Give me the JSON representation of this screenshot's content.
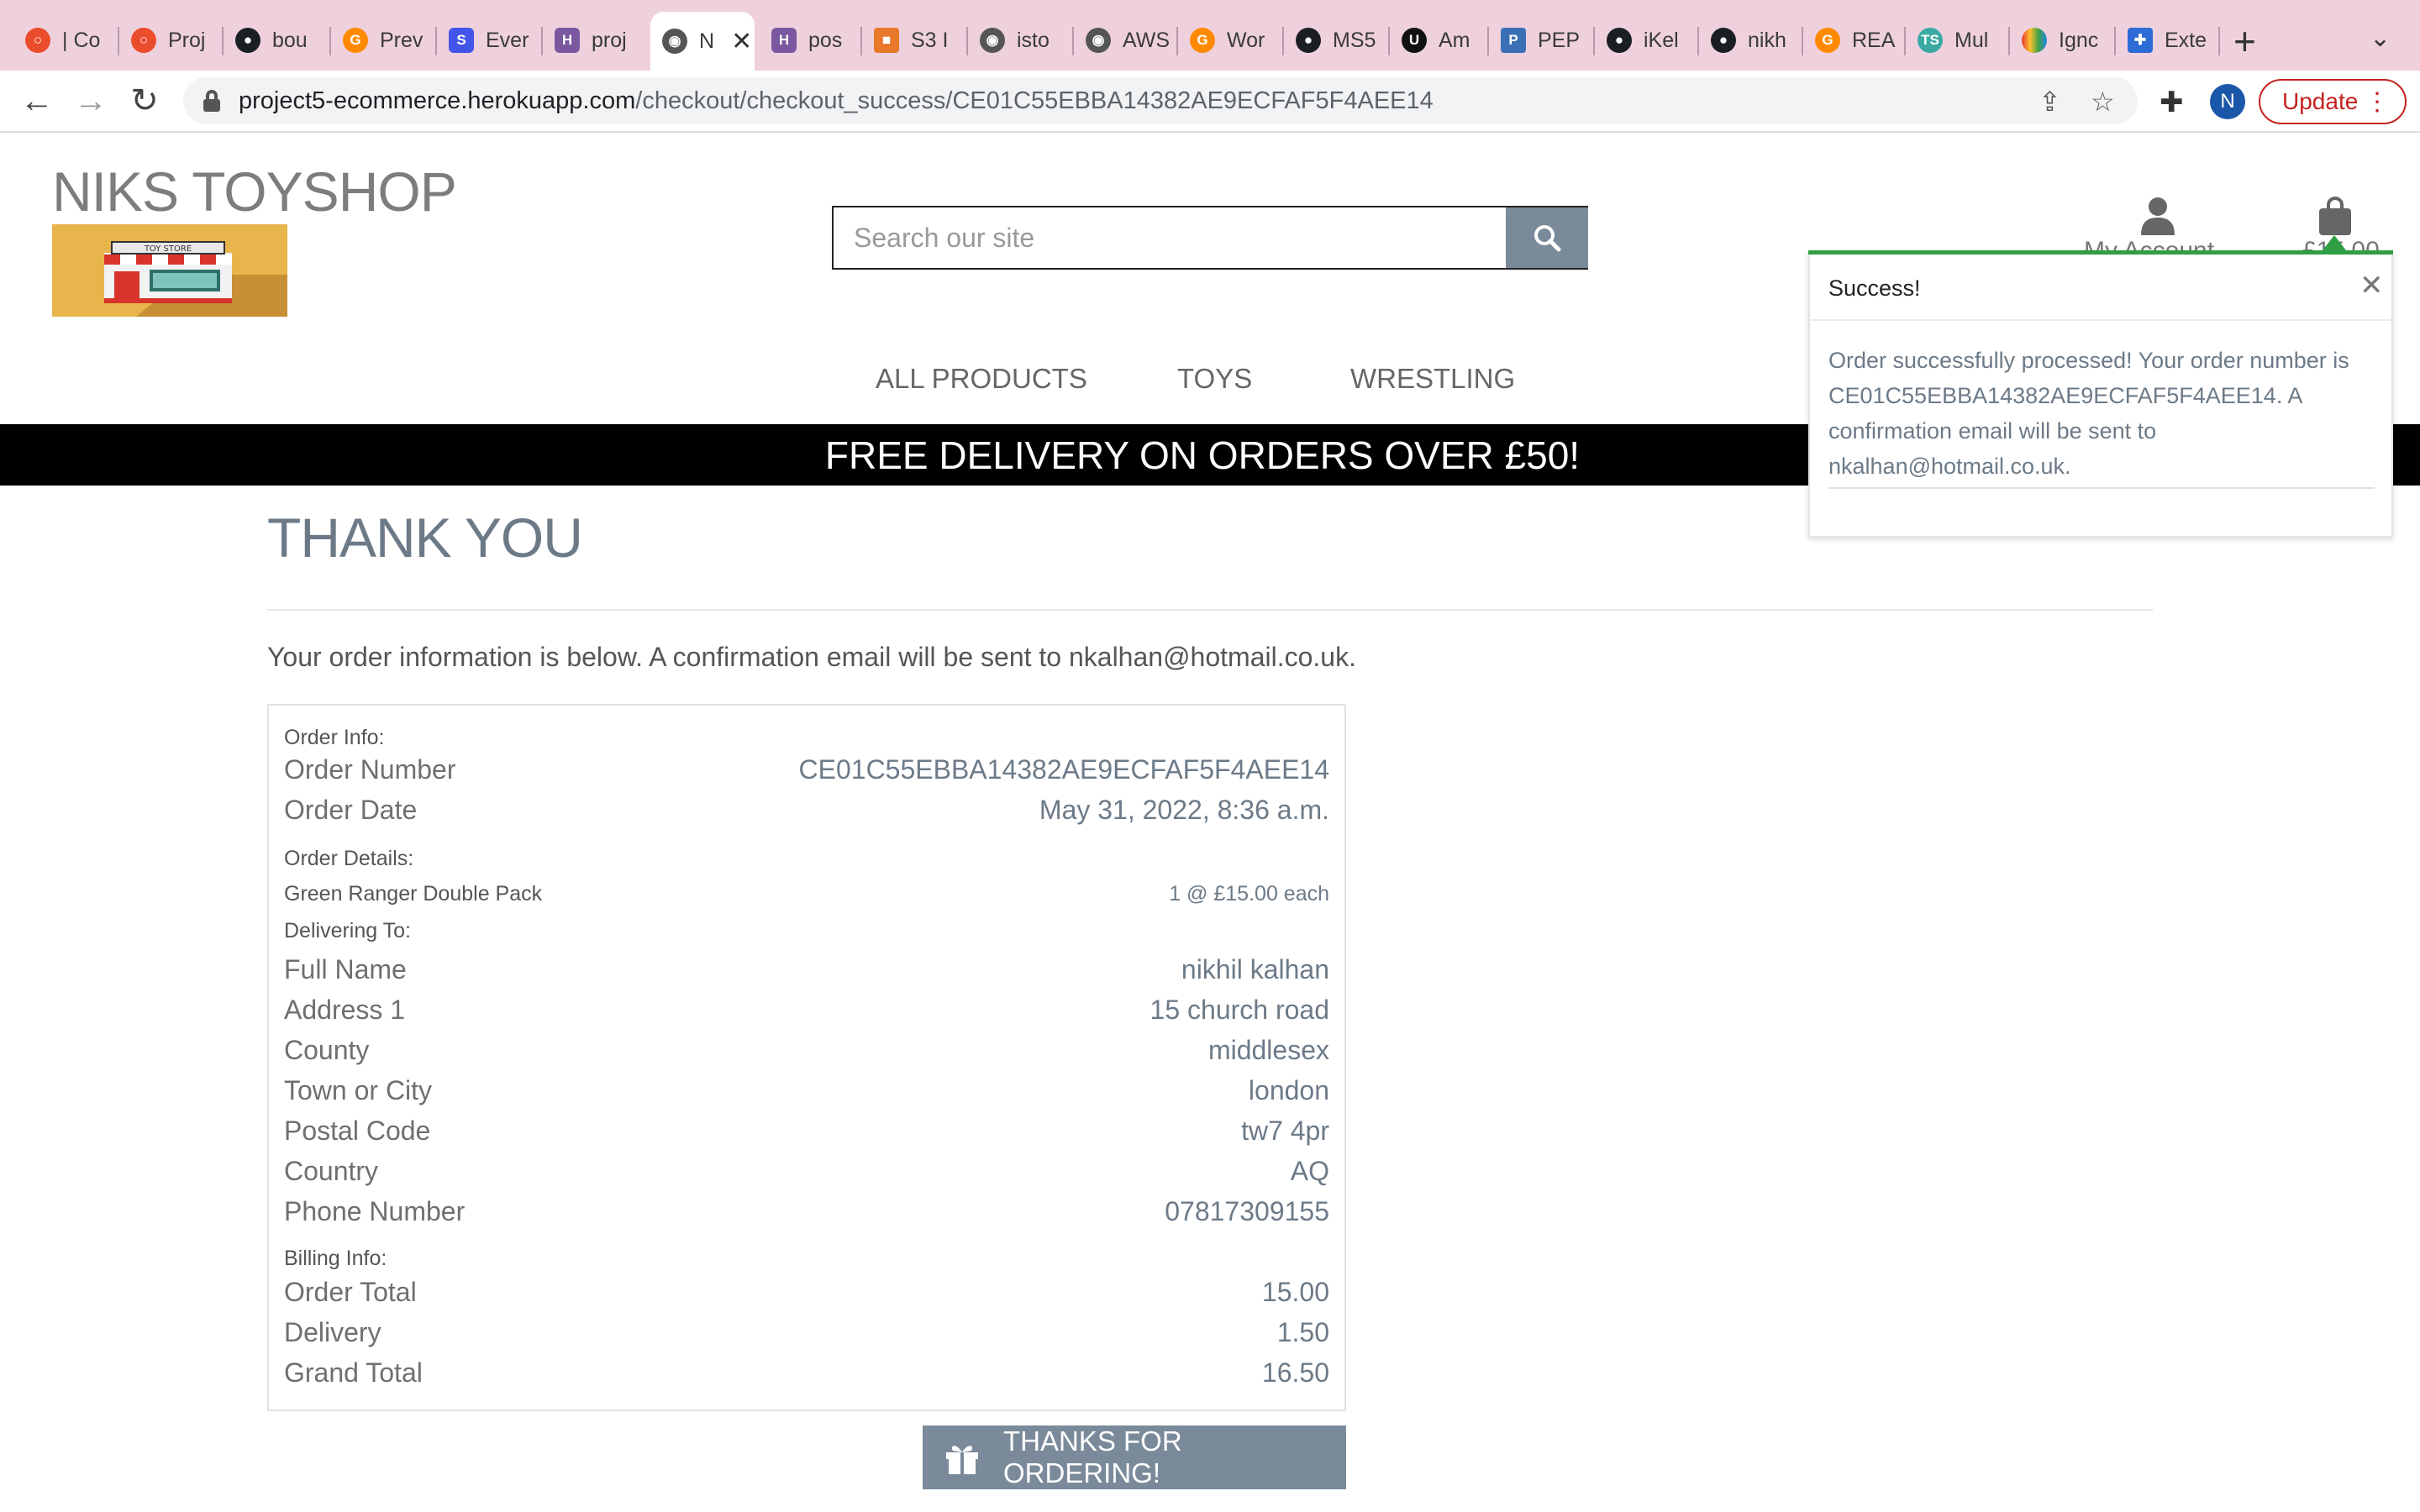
{
  "browser": {
    "tabs": [
      {
        "label": "| Co",
        "icon": "opera-icon"
      },
      {
        "label": "Proj",
        "icon": "opera-icon"
      },
      {
        "label": "bou",
        "icon": "github-icon"
      },
      {
        "label": "Prev",
        "icon": "gitpod-icon"
      },
      {
        "label": "Ever",
        "icon": "s-icon"
      },
      {
        "label": "proj",
        "icon": "heroku-icon"
      },
      {
        "label": "N",
        "icon": "globe-icon"
      },
      {
        "label": "pos",
        "icon": "heroku-icon"
      },
      {
        "label": "S3 I",
        "icon": "aws-box-icon"
      },
      {
        "label": "isto",
        "icon": "globe-icon"
      },
      {
        "label": "AWS",
        "icon": "globe-icon"
      },
      {
        "label": "Wor",
        "icon": "gitpod-icon"
      },
      {
        "label": "MS5",
        "icon": "github-icon"
      },
      {
        "label": "Am",
        "icon": "u-icon"
      },
      {
        "label": "PEP",
        "icon": "pep-icon"
      },
      {
        "label": "iKel",
        "icon": "github-icon"
      },
      {
        "label": "nikh",
        "icon": "github-icon"
      },
      {
        "label": "REA",
        "icon": "gitpod-icon"
      },
      {
        "label": "Mul",
        "icon": "ts-icon"
      },
      {
        "label": "Ignc",
        "icon": "rainbow-icon"
      },
      {
        "label": "Exte",
        "icon": "puzzle-icon"
      }
    ],
    "url_host": "project5-ecommerce.herokuapp.com",
    "url_path": "/checkout/checkout_success/CE01C55EBBA14382AE9ECFAF5F4AEE14",
    "profile_initial": "N",
    "update_label": "Update"
  },
  "header": {
    "brand": "NIKS TOYSHOP",
    "logo_sign": "TOY STORE",
    "search_placeholder": "Search our site",
    "account_label": "My Account",
    "bag_total": "£15.00"
  },
  "nav": {
    "items": [
      "ALL PRODUCTS",
      "TOYS",
      "WRESTLING"
    ]
  },
  "banner": "FREE DELIVERY ON ORDERS OVER £50!",
  "page": {
    "title": "THANK YOU",
    "intro": "Your order information is below. A confirmation email will be sent to ",
    "intro_email": "nkalhan@hotmail.co.uk",
    "intro_end": "."
  },
  "order": {
    "order_info_heading": "Order Info:",
    "order_number_label": "Order Number",
    "order_number": "CE01C55EBBA14382AE9ECFAF5F4AEE14",
    "order_date_label": "Order Date",
    "order_date": "May 31, 2022, 8:36 a.m.",
    "order_details_heading": "Order Details:",
    "item_name": "Green Ranger Double Pack",
    "item_qty_price": "1 @ £15.00 each",
    "delivering_heading": "Delivering To:",
    "delivery_fields": [
      {
        "label": "Full Name",
        "value": "nikhil kalhan"
      },
      {
        "label": "Address 1",
        "value": "15 church road"
      },
      {
        "label": "County",
        "value": "middlesex"
      },
      {
        "label": "Town or City",
        "value": "london"
      },
      {
        "label": "Postal Code",
        "value": "tw7 4pr"
      },
      {
        "label": "Country",
        "value": "AQ"
      },
      {
        "label": "Phone Number",
        "value": "07817309155"
      }
    ],
    "billing_heading": "Billing Info:",
    "billing_fields": [
      {
        "label": "Order Total",
        "value": "15.00"
      },
      {
        "label": "Delivery",
        "value": "1.50"
      },
      {
        "label": "Grand Total",
        "value": "16.50"
      }
    ]
  },
  "thanks_button": "THANKS FOR ORDERING!",
  "toast": {
    "title": "Success!",
    "message": "Order successfully processed! Your order number is CE01C55EBBA14382AE9ECFAF5F4AEE14. A confirmation email will be sent to nkalhan@hotmail.co.uk.",
    "accent_color": "#2f9e44"
  },
  "colors": {
    "accent_slate": "#7a8a9a",
    "banner_bg": "#000000",
    "tabbar_bg": "#efd1de"
  }
}
